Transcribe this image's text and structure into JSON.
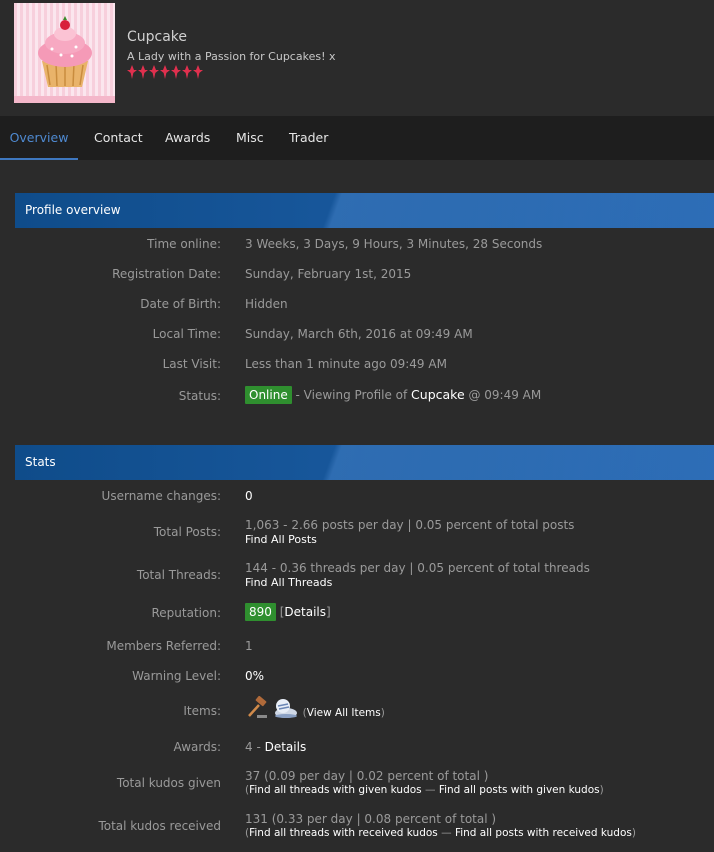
{
  "profile": {
    "username": "Cupcake",
    "usertitle": "A Lady with a Passion for Cupcakes! x"
  },
  "tabs": [
    "Overview",
    "Contact",
    "Awards",
    "Misc",
    "Trader"
  ],
  "overview": {
    "heading": "Profile overview",
    "time_online_label": "Time online:",
    "time_online": "3 Weeks, 3 Days, 9 Hours, 3 Minutes, 28 Seconds",
    "reg_label": "Registration Date:",
    "reg_date": "Sunday, February 1st, 2015",
    "dob_label": "Date of Birth:",
    "dob": "Hidden",
    "local_label": "Local Time:",
    "local_time": "Sunday, March 6th, 2016 at 09:49 AM",
    "visit_label": "Last Visit:",
    "last_visit": "Less than 1 minute ago 09:49 AM",
    "status_label": "Status:",
    "status_badge": "Online",
    "status_pre": " - Viewing Profile of ",
    "status_user": "Cupcake",
    "status_post": " @ 09:49 AM"
  },
  "stats": {
    "heading": "Stats",
    "username_changes_label": "Username changes:",
    "username_changes": "0",
    "posts_label": "Total Posts:",
    "posts": "1,063 - 2.66 posts per day | 0.05 percent of total posts",
    "posts_link": "Find All Posts",
    "threads_label": "Total Threads:",
    "threads": "144 - 0.36 threads per day | 0.05 percent of total threads",
    "threads_link": "Find All Threads",
    "rep_label": "Reputation:",
    "rep_value": "890",
    "rep_open": " [",
    "rep_details": "Details",
    "rep_close": "]",
    "referred_label": "Members Referred:",
    "referred": "1",
    "warning_label": "Warning Level:",
    "warning": "0%",
    "items_label": "Items:",
    "items_open": "(",
    "items_link": "View All Items",
    "items_close": ")",
    "awards_label": "Awards:",
    "awards_count": "4 - ",
    "awards_link": "Details",
    "kudos_given_label": "Total kudos given",
    "kudos_given": "37 (0.09 per day | 0.02 percent of total )",
    "kudos_given_open": "(",
    "kudos_given_link1": "Find all threads with given kudos",
    "kudos_given_sep": " — ",
    "kudos_given_link2": "Find all posts with given kudos",
    "kudos_given_close": ")",
    "kudos_recv_label": "Total kudos received",
    "kudos_recv": "131 (0.33 per day | 0.08 percent of total )",
    "kudos_recv_open": "(",
    "kudos_recv_link1": "Find all threads with received kudos",
    "kudos_recv_sep": " — ",
    "kudos_recv_link2": "Find all posts with received kudos",
    "kudos_recv_close": ")"
  },
  "colors": {
    "accent": "#3e77bf",
    "header_bar": "#1a5aa0",
    "badge_green": "#2f8f2f",
    "star_red": "#e0304e"
  },
  "icons": [
    "cupcake-avatar",
    "star-icon",
    "gavel-icon",
    "sneaker-icon"
  ]
}
